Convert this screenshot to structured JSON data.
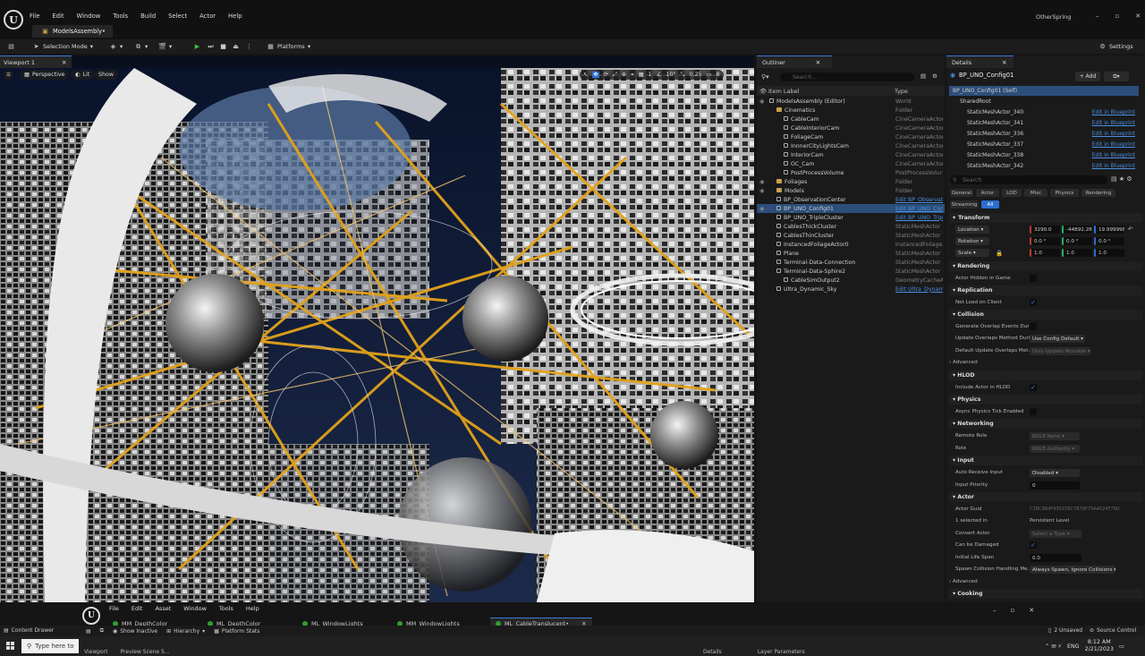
{
  "app": {
    "menu": [
      "File",
      "Edit",
      "Window",
      "Tools",
      "Build",
      "Select",
      "Actor",
      "Help"
    ],
    "project_tab": "ModelsAssembly•",
    "user": "OtherSpring",
    "win_controls": [
      "–",
      "▫",
      "✕"
    ]
  },
  "toolbar": {
    "selection_mode": "Selection Mode",
    "platforms": "Platforms",
    "settings": "Settings"
  },
  "viewport": {
    "tab": "Viewport 1",
    "perspective": "Perspective",
    "lit": "Lit",
    "show": "Show",
    "grid_val": "1",
    "angle_val": "10°",
    "scale_val": "0.25",
    "cam_val": "8"
  },
  "outliner": {
    "tab": "Outliner",
    "search_placeholder": "Search...",
    "col_label": "Item Label",
    "col_type": "Type",
    "rows": [
      {
        "label": "ModelsAssembly (Editor)",
        "type": "World",
        "indent": 0,
        "kind": "world"
      },
      {
        "label": "Cinematics",
        "type": "Folder",
        "indent": 1,
        "kind": "folder"
      },
      {
        "label": "CableCam",
        "type": "CineCameraActor",
        "indent": 2,
        "kind": "actor"
      },
      {
        "label": "CableInteriorCam",
        "type": "CineCameraActor",
        "indent": 2,
        "kind": "actor"
      },
      {
        "label": "FoliageCam",
        "type": "CineCameraActor",
        "indent": 2,
        "kind": "actor"
      },
      {
        "label": "InnnerCityLightsCam",
        "type": "CineCameraActor",
        "indent": 2,
        "kind": "actor"
      },
      {
        "label": "InteriorCam",
        "type": "CineCameraActor",
        "indent": 2,
        "kind": "actor"
      },
      {
        "label": "OC_Cam",
        "type": "CineCameraActor",
        "indent": 2,
        "kind": "actor"
      },
      {
        "label": "PostProcessVolume",
        "type": "PostProcessVolur",
        "indent": 2,
        "kind": "actor"
      },
      {
        "label": "Foliages",
        "type": "Folder",
        "indent": 1,
        "kind": "folder"
      },
      {
        "label": "Models",
        "type": "Folder",
        "indent": 1,
        "kind": "folder"
      },
      {
        "label": "BP_ObservationCenter",
        "type": "Edit BP_Observati",
        "indent": 1,
        "kind": "actor",
        "link": true
      },
      {
        "label": "BP_UNO_Config01",
        "type": "Edit BP_UNO_Con",
        "indent": 1,
        "kind": "actor",
        "link": true,
        "selected": true
      },
      {
        "label": "BP_UNO_TripleCluster",
        "type": "Edit BP_UNO_Trip",
        "indent": 1,
        "kind": "actor",
        "link": true
      },
      {
        "label": "CablesThickCluster",
        "type": "StaticMeshActor",
        "indent": 1,
        "kind": "actor"
      },
      {
        "label": "CablesThinCluster",
        "type": "StaticMeshActor",
        "indent": 1,
        "kind": "actor"
      },
      {
        "label": "InstancedFoliageActor0",
        "type": "InstancedFoliageA",
        "indent": 1,
        "kind": "actor"
      },
      {
        "label": "Plane",
        "type": "StaticMeshActor",
        "indent": 1,
        "kind": "actor"
      },
      {
        "label": "Terminal-Data-Connection",
        "type": "StaticMeshActor",
        "indent": 1,
        "kind": "actor"
      },
      {
        "label": "Terminal-Data-Sphire2",
        "type": "StaticMeshActor",
        "indent": 1,
        "kind": "actor"
      },
      {
        "label": "CableSimOutput2",
        "type": "GeometryCacheA",
        "indent": 2,
        "kind": "actor"
      },
      {
        "label": "Ultra_Dynamic_Sky",
        "type": "Edit Ultra_Dynami",
        "indent": 1,
        "kind": "actor",
        "link": true
      }
    ]
  },
  "details": {
    "tab": "Details",
    "actor_name": "BP_UNO_Config01",
    "add_label": "+ Add",
    "components": [
      {
        "label": "BP_UNO_Config01 (Self)",
        "link": "",
        "indent": 0,
        "selected": true
      },
      {
        "label": "SharedRoot",
        "link": "",
        "indent": 1
      },
      {
        "label": "StaticMeshActor_340",
        "link": "Edit in Blueprint",
        "indent": 2
      },
      {
        "label": "StaticMeshActor_341",
        "link": "Edit in Blueprint",
        "indent": 2
      },
      {
        "label": "StaticMeshActor_336",
        "link": "Edit in Blueprint",
        "indent": 2
      },
      {
        "label": "StaticMeshActor_337",
        "link": "Edit in Blueprint",
        "indent": 2
      },
      {
        "label": "StaticMeshActor_338",
        "link": "Edit in Blueprint",
        "indent": 2
      },
      {
        "label": "StaticMeshActor_342",
        "link": "Edit in Blueprint",
        "indent": 2
      }
    ],
    "search_placeholder": "Search",
    "filter_tabs": [
      "General",
      "Actor",
      "LOD",
      "Misc",
      "Physics",
      "Rendering"
    ],
    "filter_tabs2": [
      "Streaming",
      "All"
    ],
    "transform": {
      "title": "Transform",
      "location_label": "Location",
      "rotation_label": "Rotation",
      "scale_label": "Scale",
      "location": [
        "3290.0",
        "-44892.28(",
        "19.999998"
      ],
      "rotation": [
        "0.0 °",
        "0.0 °",
        "0.0 °"
      ],
      "scale": [
        "1.0",
        "1.0",
        "1.0"
      ]
    },
    "sections": {
      "rendering": "Rendering",
      "actor_hidden": "Actor Hidden in Game",
      "replication": "Replication",
      "net_load": "Net Load on Client",
      "collision": "Collision",
      "gen_overlap": "Generate Overlap Events Duri...",
      "update_overlap": "Update Overlaps Method Duri...",
      "update_overlap_val": "Use Config Default",
      "default_update": "Default Update Overlaps Met...",
      "default_update_val": "Only Update Movable",
      "advanced": "Advanced",
      "hlod": "HLOD",
      "include_hlod": "Include Actor in HLOD",
      "physics": "Physics",
      "async_physics": "Async Physics Tick Enabled",
      "networking": "Networking",
      "remote_role": "Remote Role",
      "remote_role_val": "ROLE None",
      "role": "Role",
      "role_val": "ROLE Authority",
      "input": "Input",
      "auto_receive": "Auto Receive Input",
      "auto_receive_val": "Disabled",
      "input_priority": "Input Priority",
      "input_priority_val": "0",
      "actor": "Actor",
      "actor_guid": "Actor Guid",
      "actor_guid_val": "C3BC9B4F43915BC7B7AF79A4024F79D",
      "selected_in": "1 selected in",
      "selected_in_val": "Persistent Level",
      "convert_actor": "Convert Actor",
      "convert_actor_val": "Select a Type",
      "can_be_damaged": "Can be Damaged",
      "initial_life": "Initial Life Span",
      "initial_life_val": "0.0",
      "spawn_collision": "Spawn Collision Handling Me...",
      "spawn_collision_val": "Always Spawn, Ignore Collisions",
      "advanced2": "Advanced",
      "cooking": "Cooking"
    }
  },
  "material_editor": {
    "menu": [
      "File",
      "Edit",
      "Asset",
      "Window",
      "Tools",
      "Help"
    ],
    "tabs": [
      "MM_DepthColor",
      "ML_DepthColor",
      "ML_WindowLights",
      "MM_WindowLights",
      "ML_CableTranslucent•"
    ],
    "show_inactive": "Show Inactive",
    "hierarchy": "Hierarchy",
    "platform_stats": "Platform Stats"
  },
  "drawer": {
    "content_drawer": "Content Drawer",
    "unsaved": "2 Unsaved",
    "source_control": "Source Control"
  },
  "taskbar": {
    "search_placeholder": "Type here to",
    "lang": "ENG",
    "time": "8:12 AM",
    "date": "2/21/2023",
    "bottom_tabs": [
      "Viewport",
      "Preview Scene S...",
      "Details",
      "Layer Parameters"
    ]
  }
}
